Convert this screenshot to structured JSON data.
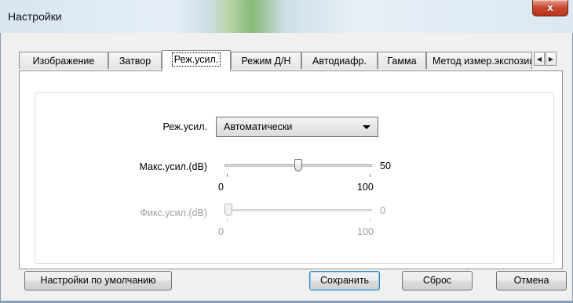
{
  "window": {
    "title": "Настройки",
    "close_glyph": "x"
  },
  "tabs": [
    {
      "label": "Изображение"
    },
    {
      "label": "Затвор"
    },
    {
      "label": "Реж.усил.",
      "active": true
    },
    {
      "label": "Режим Д/Н"
    },
    {
      "label": "Автодиафр."
    },
    {
      "label": "Гамма"
    },
    {
      "label": "Метод измер.экспозиции"
    }
  ],
  "tab_scroll": {
    "left_icon": "◀",
    "right_icon": "▶"
  },
  "gain_mode": {
    "label": "Реж.усил.",
    "value": "Автоматически"
  },
  "max_gain": {
    "label": "Макс.усил.(dB)",
    "value": "50",
    "min": "0",
    "max": "100",
    "position": 0.5
  },
  "fixed_gain": {
    "label": "Фикс.усил.(dB)",
    "value": "0",
    "min": "0",
    "max": "100",
    "position": 0.0,
    "enabled": false
  },
  "buttons": {
    "defaults": "Настройки по умолчанию",
    "save": "Сохранить",
    "reset": "Сброс",
    "cancel": "Отмена"
  }
}
